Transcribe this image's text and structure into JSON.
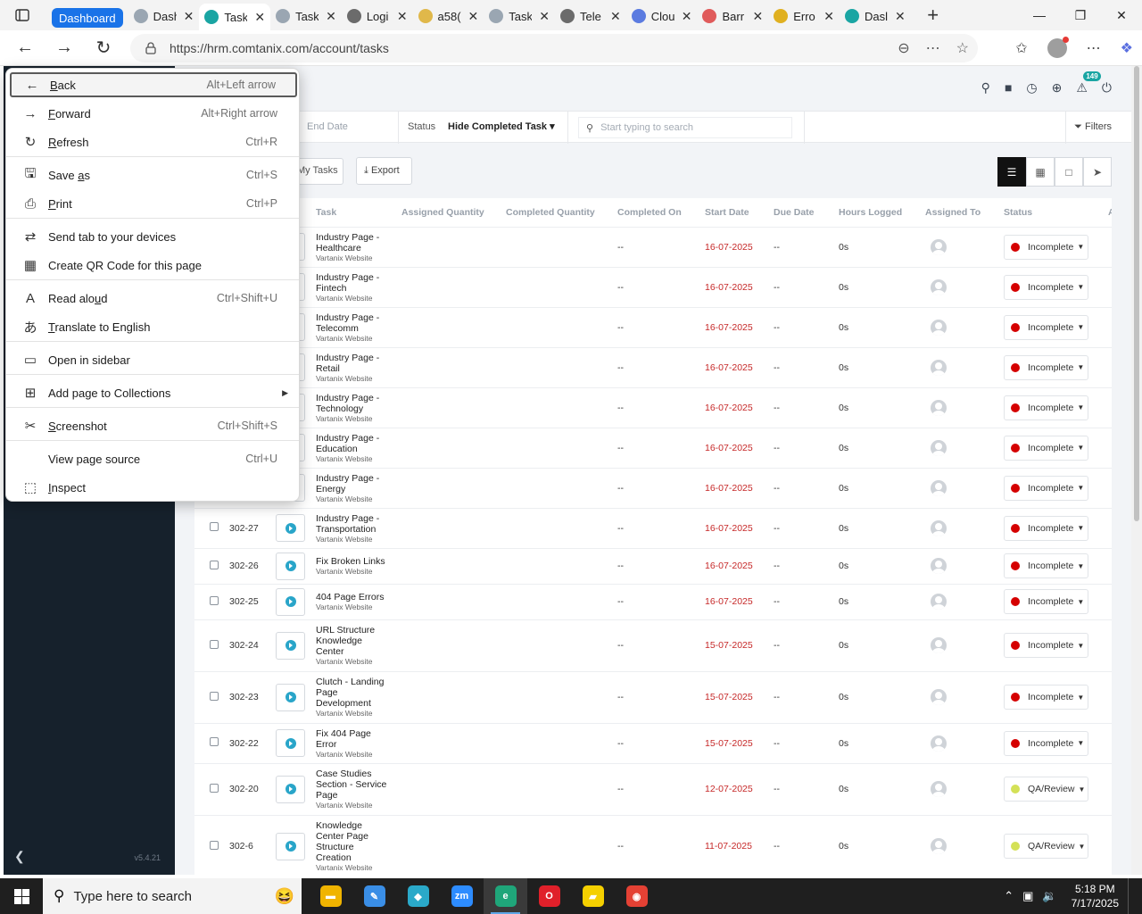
{
  "browser": {
    "tab_group_label": "Dashboard",
    "tabs": [
      {
        "title": "Dash",
        "icon": "app-logo-icon",
        "color": "#9aa6b2"
      },
      {
        "title": "Task",
        "icon": "app-logo-icon",
        "color": "#1aa5a3",
        "active": true
      },
      {
        "title": "Task",
        "icon": "app-logo-icon",
        "color": "#9aa6b2"
      },
      {
        "title": "Logi",
        "icon": "k-logo-icon",
        "color": "#6b6b6b"
      },
      {
        "title": "a58(",
        "icon": "w-logo-icon",
        "color": "#e0b84a"
      },
      {
        "title": "Task",
        "icon": "app-logo-icon",
        "color": "#9aa6b2"
      },
      {
        "title": "Tele",
        "icon": "k-logo-icon",
        "color": "#6b6b6b"
      },
      {
        "title": "Clou",
        "icon": "doc-icon",
        "color": "#5b7be0"
      },
      {
        "title": "Barr",
        "icon": "diamond-icon",
        "color": "#e05b5b"
      },
      {
        "title": "Erro",
        "icon": "w-logo-icon",
        "color": "#e0b020"
      },
      {
        "title": "Dasl",
        "icon": "app-logo-icon",
        "color": "#1aa5a3"
      }
    ],
    "url": "https://hrm.comtanix.com/account/tasks"
  },
  "context_menu": {
    "items": [
      {
        "icon": "←",
        "label": "Back",
        "underline": 0,
        "shortcut": "Alt+Left arrow",
        "selected": true
      },
      {
        "icon": "→",
        "label": "Forward",
        "underline": 0,
        "shortcut": "Alt+Right arrow"
      },
      {
        "icon": "↻",
        "label": "Refresh",
        "underline": 0,
        "shortcut": "Ctrl+R"
      },
      {
        "icon": "🖫",
        "label": "Save as",
        "underline": 5,
        "shortcut": "Ctrl+S"
      },
      {
        "icon": "⎙",
        "label": "Print",
        "underline": 0,
        "shortcut": "Ctrl+P"
      },
      {
        "icon": "⇄",
        "label": "Send tab to your devices",
        "shortcut": ""
      },
      {
        "icon": "▦",
        "label": "Create QR Code for this page",
        "shortcut": ""
      },
      {
        "icon": "A",
        "label": "Read aloud",
        "underline": 8,
        "shortcut": "Ctrl+Shift+U"
      },
      {
        "icon": "あ",
        "label": "Translate to English",
        "underline": 0,
        "shortcut": ""
      },
      {
        "icon": "▭",
        "label": "Open in sidebar",
        "shortcut": ""
      },
      {
        "icon": "⊞",
        "label": "Add page to Collections",
        "shortcut": "",
        "submenu": true
      },
      {
        "icon": "✂",
        "label": "Screenshot",
        "underline": 0,
        "shortcut": "Ctrl+Shift+S"
      },
      {
        "icon": "",
        "label": "View page source",
        "shortcut": "Ctrl+U"
      },
      {
        "icon": "⬚",
        "label": "Inspect",
        "underline": 0,
        "shortcut": ""
      }
    ]
  },
  "app": {
    "notification_count": "149",
    "version": "v5.4.21",
    "filter": {
      "date_placeholder": "End Date",
      "status_label": "Status",
      "status_value": "Hide Completed Task",
      "search_placeholder": "Start typing to search",
      "filters_label": "Filters"
    },
    "my_tasks_label": "My Tasks",
    "export_label": "Export",
    "columns": [
      "Task",
      "Assigned Quantity",
      "Completed Quantity",
      "Completed On",
      "Start Date",
      "Due Date",
      "Hours Logged",
      "Assigned To",
      "Status",
      "Acti"
    ],
    "rows": [
      {
        "code": "",
        "task": [
          "Industry Page -",
          "Healthcare"
        ],
        "project": "Vartanix Website",
        "completed_on": "--",
        "start": "16-07-2025",
        "due": "--",
        "hours": "0s",
        "status": "Incomplete",
        "status_color": "#d50000",
        "h": 45
      },
      {
        "code": "",
        "task": [
          "Industry Page -",
          "Fintech"
        ],
        "project": "Vartanix Website",
        "completed_on": "--",
        "start": "16-07-2025",
        "due": "--",
        "hours": "0s",
        "status": "Incomplete",
        "status_color": "#d50000",
        "h": 45
      },
      {
        "code": "",
        "task": [
          "Industry Page -",
          "Telecomm"
        ],
        "project": "Vartanix Website",
        "completed_on": "--",
        "start": "16-07-2025",
        "due": "--",
        "hours": "0s",
        "status": "Incomplete",
        "status_color": "#d50000",
        "h": 45
      },
      {
        "code": "",
        "task": [
          "Industry Page -",
          "Retail"
        ],
        "project": "Vartanix Website",
        "completed_on": "--",
        "start": "16-07-2025",
        "due": "--",
        "hours": "0s",
        "status": "Incomplete",
        "status_color": "#d50000",
        "h": 45
      },
      {
        "code": "",
        "task": [
          "Industry Page -",
          "Technology"
        ],
        "project": "Vartanix Website",
        "completed_on": "--",
        "start": "16-07-2025",
        "due": "--",
        "hours": "0s",
        "status": "Incomplete",
        "status_color": "#d50000",
        "h": 45
      },
      {
        "code": "",
        "task": [
          "Industry Page -",
          "Education"
        ],
        "project": "Vartanix Website",
        "completed_on": "--",
        "start": "16-07-2025",
        "due": "--",
        "hours": "0s",
        "status": "Incomplete",
        "status_color": "#d50000",
        "h": 45
      },
      {
        "code": "",
        "task": [
          "Industry Page -",
          "Energy"
        ],
        "project": "Vartanix Website",
        "completed_on": "--",
        "start": "16-07-2025",
        "due": "--",
        "hours": "0s",
        "status": "Incomplete",
        "status_color": "#d50000",
        "h": 45
      },
      {
        "code": "302-27",
        "task": [
          "Industry Page -",
          "Transportation"
        ],
        "project": "Vartanix Website",
        "completed_on": "--",
        "start": "16-07-2025",
        "due": "--",
        "hours": "0s",
        "status": "Incomplete",
        "status_color": "#d50000",
        "h": 45
      },
      {
        "code": "302-26",
        "task": [
          "Fix Broken Links"
        ],
        "project": "Vartanix Website",
        "completed_on": "--",
        "start": "16-07-2025",
        "due": "--",
        "hours": "0s",
        "status": "Incomplete",
        "status_color": "#d50000",
        "h": 40
      },
      {
        "code": "302-25",
        "task": [
          "404 Page Errors"
        ],
        "project": "Vartanix Website",
        "completed_on": "--",
        "start": "16-07-2025",
        "due": "--",
        "hours": "0s",
        "status": "Incomplete",
        "status_color": "#d50000",
        "h": 40
      },
      {
        "code": "302-24",
        "task": [
          "URL Structure",
          "Knowledge",
          "Center"
        ],
        "project": "Vartanix Website",
        "completed_on": "--",
        "start": "15-07-2025",
        "due": "--",
        "hours": "0s",
        "status": "Incomplete",
        "status_color": "#d50000",
        "h": 58
      },
      {
        "code": "302-23",
        "task": [
          "Clutch - Landing",
          "Page",
          "Development"
        ],
        "project": "Vartanix Website",
        "completed_on": "--",
        "start": "15-07-2025",
        "due": "--",
        "hours": "0s",
        "status": "Incomplete",
        "status_color": "#d50000",
        "h": 58
      },
      {
        "code": "302-22",
        "task": [
          "Fix 404 Page",
          "Error"
        ],
        "project": "Vartanix Website",
        "completed_on": "--",
        "start": "15-07-2025",
        "due": "--",
        "hours": "0s",
        "status": "Incomplete",
        "status_color": "#d50000",
        "h": 45
      },
      {
        "code": "302-20",
        "task": [
          "Case Studies",
          "Section - Service",
          "Page"
        ],
        "project": "Vartanix Website",
        "completed_on": "--",
        "start": "12-07-2025",
        "due": "--",
        "hours": "0s",
        "status": "QA/Review",
        "status_color": "#d4e157",
        "h": 58
      },
      {
        "code": "302-6",
        "task": [
          "Knowledge",
          "Center Page",
          "Structure",
          "Creation"
        ],
        "project": "Vartanix Website",
        "completed_on": "--",
        "start": "11-07-2025",
        "due": "--",
        "hours": "0s",
        "status": "QA/Review",
        "status_color": "#d4e157",
        "h": 70
      }
    ]
  },
  "taskbar": {
    "search_placeholder": "Type here to search",
    "time": "5:18 PM",
    "date": "7/17/2025",
    "apps": [
      {
        "name": "file-explorer-icon",
        "color": "#f0b400",
        "glyph": "▬"
      },
      {
        "name": "paint-icon",
        "color": "#3a8ee6",
        "glyph": "✎"
      },
      {
        "name": "app-icon",
        "color": "#2aa9c9",
        "glyph": "◆"
      },
      {
        "name": "zoom-icon",
        "color": "#2d8cff",
        "glyph": "zm"
      },
      {
        "name": "edge-icon",
        "color": "#1fa67a",
        "glyph": "e",
        "active": true
      },
      {
        "name": "opera-icon",
        "color": "#e0202a",
        "glyph": "O"
      },
      {
        "name": "sticky-notes-icon",
        "color": "#f5d000",
        "glyph": "▰"
      },
      {
        "name": "chrome-icon",
        "color": "#e44134",
        "glyph": "◉"
      }
    ]
  }
}
